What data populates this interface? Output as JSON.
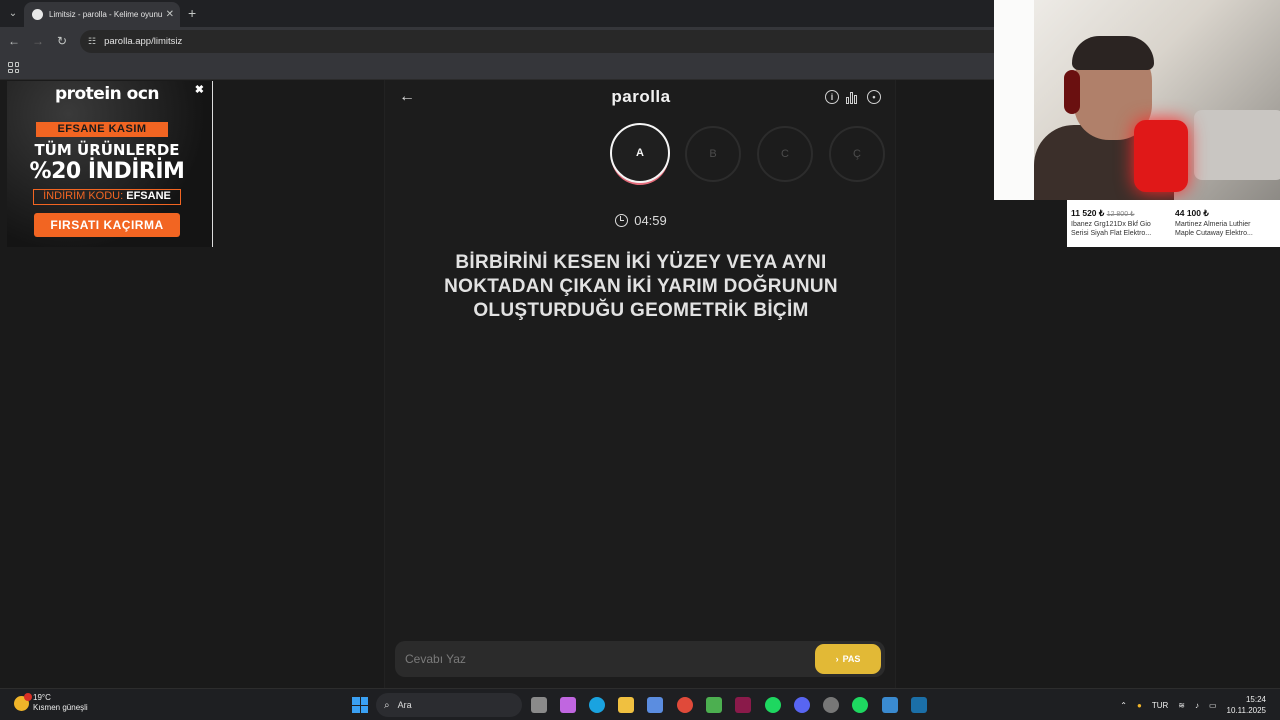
{
  "browser": {
    "tab_title": "Limitsiz - parolla - Kelime oyunu",
    "url": "parolla.app/limitsiz",
    "new_tab_glyph": "+"
  },
  "ad_left": {
    "brand": "protein ocn",
    "line1": "EFSANE KASIM",
    "line2": "TÜM ÜRÜNLERDE",
    "line3": "%20 İNDİRİM",
    "code_label": "İNDİRİM KODU:",
    "code": "EFSANE",
    "cta": "FIRSATI KAÇIRMA"
  },
  "game": {
    "logo": "parolla",
    "letters": [
      {
        "label": "A",
        "state": "active"
      },
      {
        "label": "B",
        "state": "pending"
      },
      {
        "label": "C",
        "state": "pending"
      },
      {
        "label": "Ç",
        "state": "pending"
      }
    ],
    "timer": "04:59",
    "question": "BİRBİRİNİ KESEN İKİ YÜZEY VEYA AYNI NOKTADAN ÇIKAN İKİ YARIM DOĞRUNUN OLUŞTURDUĞU GEOMETRİK BİÇİM",
    "answer_placeholder": "Cevabı Yaz",
    "pas_label": "PAS"
  },
  "ad_right": {
    "products": [
      {
        "price": "11 520 ₺",
        "old_price": "12 800 ₺",
        "name": "Ibanez Grg121Dx Bkf Gio Serisi Siyah Flat Elektro..."
      },
      {
        "price": "44 100 ₺",
        "old_price": "",
        "name": "Martinez Almeria Luthier Maple Cutaway Elektro..."
      }
    ]
  },
  "taskbar": {
    "temperature": "19°C",
    "weather_text": "Kısmen güneşli",
    "search_placeholder": "Ara",
    "language": "TUR",
    "time": "15:24",
    "date": "10.11.2025"
  },
  "colors": {
    "accent_yellow": "#e2b936",
    "active_ring": "#e36b7a",
    "ad_orange": "#f26522"
  }
}
